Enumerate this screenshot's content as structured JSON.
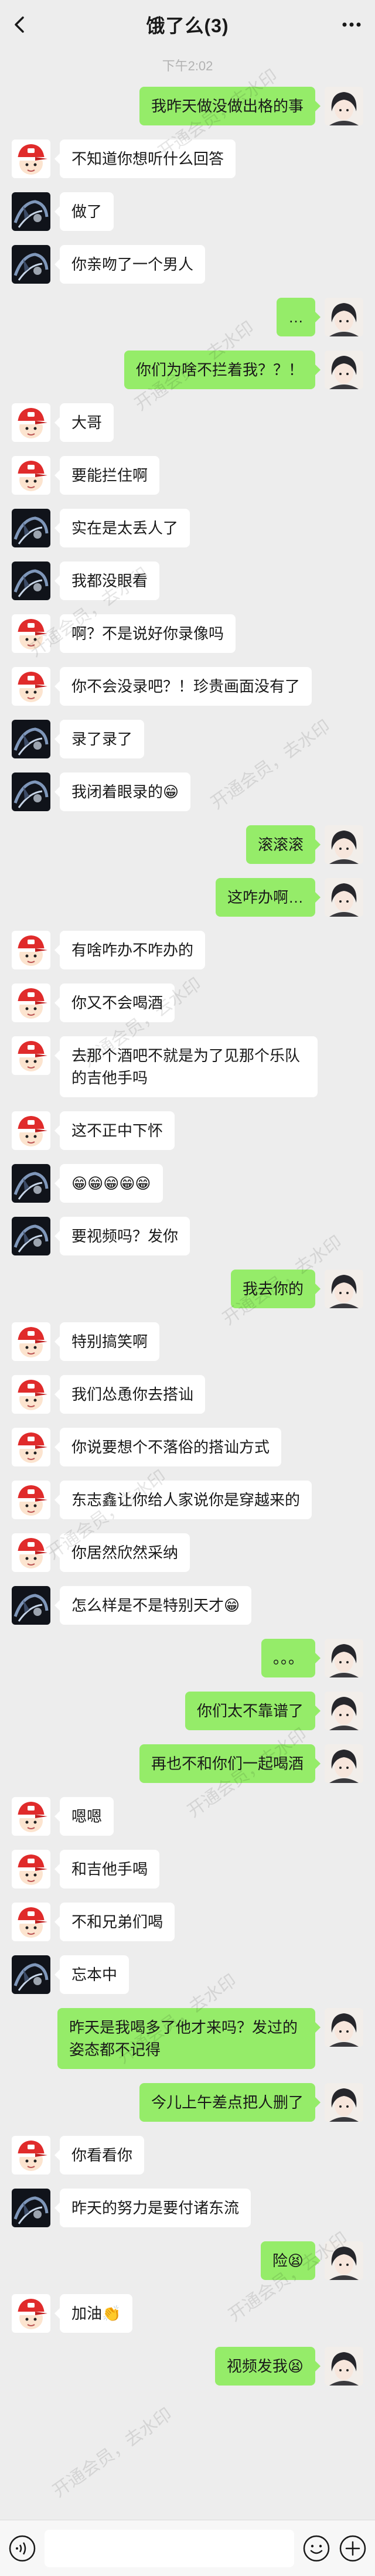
{
  "header": {
    "title": "饿了么(3)",
    "back_icon": "chevron-left-icon",
    "more_icon": "more-dots-icon"
  },
  "timestamp": "下午2:02",
  "colors": {
    "background": "#EDEDED",
    "left_bubble": "#FFFFFF",
    "right_bubble": "#95EC69",
    "text": "#191919",
    "timestamp": "#B2B2B2",
    "input_bar": "#F7F7F7"
  },
  "watermark": "开通会员，去水印",
  "messages": [
    {
      "side": "right",
      "avatar": "self-avatar",
      "text": "我昨天做没做出格的事"
    },
    {
      "side": "left",
      "avatar": "red-cap-avatar",
      "text": "不知道你想听什么回答"
    },
    {
      "side": "left",
      "avatar": "dark-avatar",
      "text": "做了"
    },
    {
      "side": "left",
      "avatar": "dark-avatar",
      "text": "你亲吻了一个男人"
    },
    {
      "side": "right",
      "avatar": "self-avatar",
      "text": "…"
    },
    {
      "side": "right",
      "avatar": "self-avatar",
      "text": "你们为啥不拦着我？？！"
    },
    {
      "side": "left",
      "avatar": "red-cap-avatar",
      "text": "大哥"
    },
    {
      "side": "left",
      "avatar": "red-cap-avatar",
      "text": "要能拦住啊"
    },
    {
      "side": "left",
      "avatar": "dark-avatar",
      "text": "实在是太丢人了"
    },
    {
      "side": "left",
      "avatar": "dark-avatar",
      "text": "我都没眼看"
    },
    {
      "side": "left",
      "avatar": "red-cap-avatar",
      "text": "啊？不是说好你录像吗"
    },
    {
      "side": "left",
      "avatar": "red-cap-avatar",
      "text": "你不会没录吧？！珍贵画面没有了"
    },
    {
      "side": "left",
      "avatar": "dark-avatar",
      "text": "录了录了"
    },
    {
      "side": "left",
      "avatar": "dark-avatar",
      "text": "我闭着眼录的😁"
    },
    {
      "side": "right",
      "avatar": "self-avatar",
      "text": "滚滚滚"
    },
    {
      "side": "right",
      "avatar": "self-avatar",
      "text": "这咋办啊…"
    },
    {
      "side": "left",
      "avatar": "red-cap-avatar",
      "text": "有啥咋办不咋办的"
    },
    {
      "side": "left",
      "avatar": "red-cap-avatar",
      "text": "你又不会喝酒"
    },
    {
      "side": "left",
      "avatar": "red-cap-avatar",
      "text": "去那个酒吧不就是为了见那个乐队的吉他手吗"
    },
    {
      "side": "left",
      "avatar": "red-cap-avatar",
      "text": "这不正中下怀"
    },
    {
      "side": "left",
      "avatar": "dark-avatar",
      "text": "😁😁😁😁😁"
    },
    {
      "side": "left",
      "avatar": "dark-avatar",
      "text": "要视频吗？发你"
    },
    {
      "side": "right",
      "avatar": "self-avatar",
      "text": "我去你的"
    },
    {
      "side": "left",
      "avatar": "red-cap-avatar",
      "text": "特别搞笑啊"
    },
    {
      "side": "left",
      "avatar": "red-cap-avatar",
      "text": "我们怂恿你去搭讪"
    },
    {
      "side": "left",
      "avatar": "red-cap-avatar",
      "text": "你说要想个不落俗的搭讪方式"
    },
    {
      "side": "left",
      "avatar": "red-cap-avatar",
      "text": "东志鑫让你给人家说你是穿越来的"
    },
    {
      "side": "left",
      "avatar": "red-cap-avatar",
      "text": "你居然欣然采纳"
    },
    {
      "side": "left",
      "avatar": "dark-avatar",
      "text": "怎么样是不是特别天才😁"
    },
    {
      "side": "right",
      "avatar": "self-avatar",
      "text": "。。。"
    },
    {
      "side": "right",
      "avatar": "self-avatar",
      "text": "你们太不靠谱了"
    },
    {
      "side": "right",
      "avatar": "self-avatar",
      "text": "再也不和你们一起喝酒"
    },
    {
      "side": "left",
      "avatar": "red-cap-avatar",
      "text": "嗯嗯"
    },
    {
      "side": "left",
      "avatar": "red-cap-avatar",
      "text": "和吉他手喝"
    },
    {
      "side": "left",
      "avatar": "red-cap-avatar",
      "text": "不和兄弟们喝"
    },
    {
      "side": "left",
      "avatar": "dark-avatar",
      "text": "忘本中"
    },
    {
      "side": "right",
      "avatar": "self-avatar",
      "text": "昨天是我喝多了他才来吗？发过的姿态都不记得"
    },
    {
      "side": "right",
      "avatar": "self-avatar",
      "text": "今儿上午差点把人删了"
    },
    {
      "side": "left",
      "avatar": "red-cap-avatar",
      "text": "你看看你"
    },
    {
      "side": "left",
      "avatar": "dark-avatar",
      "text": "昨天的努力是要付诸东流"
    },
    {
      "side": "right",
      "avatar": "self-avatar",
      "text": "险😫"
    },
    {
      "side": "left",
      "avatar": "red-cap-avatar",
      "text": "加油👏"
    },
    {
      "side": "right",
      "avatar": "self-avatar",
      "text": "视频发我😫"
    }
  ],
  "input_bar": {
    "voice_icon": "voice-icon",
    "input_value": "",
    "emoji_icon": "emoji-icon",
    "plus_icon": "plus-icon"
  }
}
